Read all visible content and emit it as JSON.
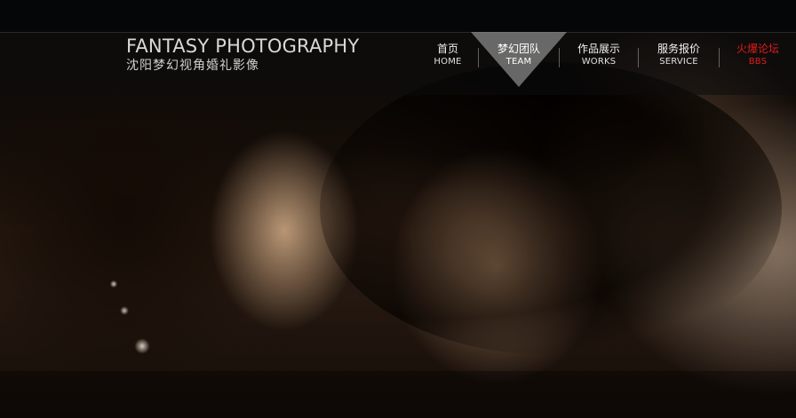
{
  "brand": {
    "title_en": "FANTASY PHOTOGRAPHY",
    "subtitle_cn": "沈阳梦幻视角婚礼影像"
  },
  "nav": {
    "items": [
      {
        "cn": "首页",
        "en": "HOME",
        "state": "normal"
      },
      {
        "cn": "梦幻团队",
        "en": "TEAM",
        "state": "active"
      },
      {
        "cn": "作品展示",
        "en": "WORKS",
        "state": "normal"
      },
      {
        "cn": "服务报价",
        "en": "SERVICE",
        "state": "normal"
      },
      {
        "cn": "火爆论坛",
        "en": "BBS",
        "state": "highlight"
      }
    ]
  },
  "colors": {
    "background": "#050608",
    "header_overlay": "rgba(12,12,12,0.55)",
    "active_tab": "rgba(155,155,155,0.65)",
    "highlight_red": "#e11b1b",
    "text_light": "#d9d9d9"
  }
}
